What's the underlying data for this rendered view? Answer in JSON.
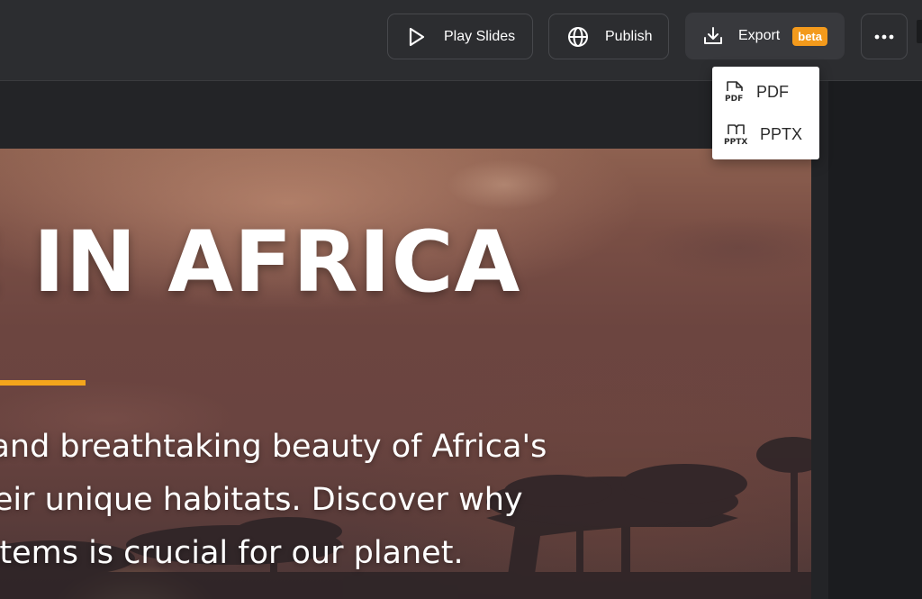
{
  "toolbar": {
    "play_label": "Play Slides",
    "publish_label": "Publish",
    "export_label": "Export",
    "export_badge": "beta",
    "more_icon": "ellipsis-icon",
    "icons": {
      "play": "play-icon",
      "publish": "globe-icon",
      "export": "download-icon"
    }
  },
  "export_menu": {
    "items": [
      {
        "label": "PDF",
        "icon": "pdf-file-icon",
        "icon_text": "PDF"
      },
      {
        "label": "PPTX",
        "icon": "pptx-file-icon",
        "icon_text": "PPTX"
      }
    ]
  },
  "slide": {
    "title": "E IN AFRICA",
    "body_lines": [
      "ersity and breathtaking beauty of Africa's",
      "and their unique habitats. Discover why",
      "ecosystems is crucial for our planet."
    ],
    "accent_color": "#f4a51c"
  },
  "colors": {
    "background": "#232427",
    "toolbar": "#2c2d30",
    "badge": "#f39a1c"
  }
}
